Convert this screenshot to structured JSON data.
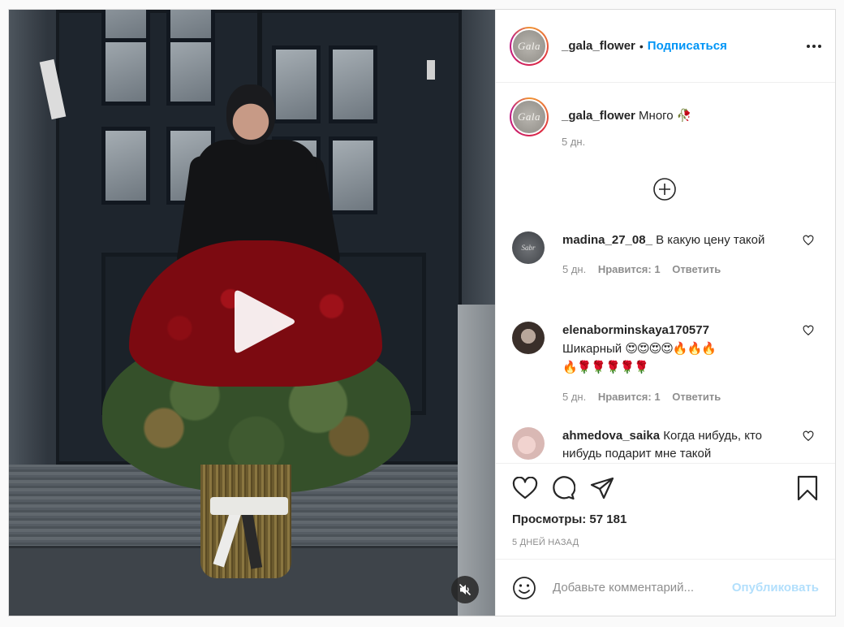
{
  "post": {
    "username": "_gala_flower",
    "avatar_text": "Gala",
    "follow_label": "Подписаться",
    "caption_text": "Много",
    "caption_emoji": "🥀",
    "caption_time": "5 дн."
  },
  "comments": [
    {
      "username": "madina_27_08_",
      "text": "В какую цену такой",
      "avatar_text": "Sabr",
      "time": "5 дн.",
      "likes": "Нравится: 1",
      "reply": "Ответить"
    },
    {
      "username": "elenaborminskaya170577",
      "text": "Шикарный",
      "emoji_line1": "😍😍😍😍🔥🔥🔥",
      "emoji_line2": "🔥🌹🌹🌹🌹🌹",
      "time": "5 дн.",
      "likes": "Нравится: 1",
      "reply": "Ответить"
    },
    {
      "username": "ahmedova_saika",
      "text": "Когда нибудь, кто нибудь подарит мне такой"
    }
  ],
  "actions": {
    "views_label": "Просмотры: 57 181",
    "posted_ago": "5 ДНЕЙ НАЗАД"
  },
  "composer": {
    "placeholder": "Добавьте комментарий...",
    "publish_label": "Опубликовать"
  },
  "colors": {
    "accent": "#0095f6",
    "publish_disabled": "#b2dffc",
    "muted": "#8e8e8e",
    "text": "#262626"
  },
  "icons": [
    "play-icon",
    "mute-icon",
    "more-icon",
    "add-circle-icon",
    "heart-icon",
    "comment-icon",
    "share-icon",
    "bookmark-icon",
    "smile-icon"
  ]
}
